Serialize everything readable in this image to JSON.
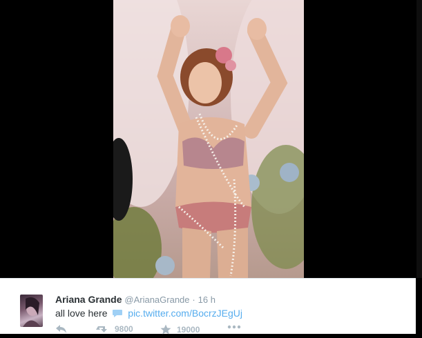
{
  "tweet": {
    "author_name": "Ariana Grande",
    "handle": "@ArianaGrande",
    "separator": "·",
    "time": "16 h",
    "text": "all love here",
    "link": "pic.twitter.com/BocrzJEgUj",
    "retweet_count": "9800",
    "favorite_count": "19000"
  },
  "icons": {
    "reply": "reply-icon",
    "retweet": "retweet-icon",
    "favorite": "star-icon",
    "more": "more-icon",
    "speech": "speech-bubble-icon"
  },
  "colors": {
    "link": "#55acee",
    "name": "#292f33",
    "muted": "#8899a6",
    "action": "#aab8c2"
  }
}
